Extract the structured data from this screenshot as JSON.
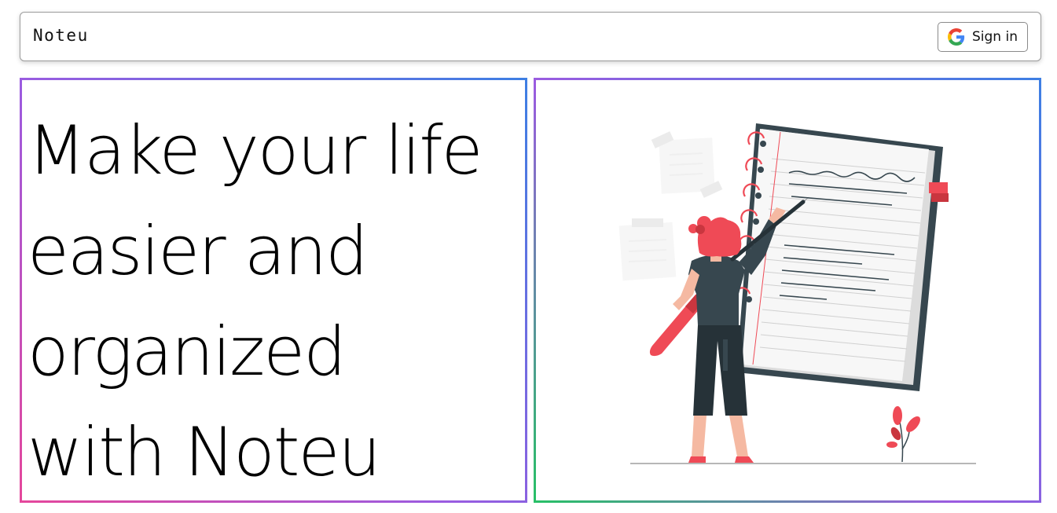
{
  "header": {
    "brand": "Noteu",
    "signin_label": "Sign in",
    "signin_icon": "google-icon"
  },
  "hero": {
    "lines": [
      "Make your life",
      "easier and",
      "organized",
      "with Noteu"
    ]
  },
  "illustration": {
    "icon": "woman-writing-notebook-illustration"
  },
  "colors": {
    "left_border_gradient": [
      "#e5479b",
      "#9b5be0",
      "#3d7fe3"
    ],
    "right_border_gradient": [
      "#27c066",
      "#9b5be0",
      "#3d7fe3"
    ],
    "accent_red": "#ef4a56",
    "dark_teal": "#37474f"
  }
}
